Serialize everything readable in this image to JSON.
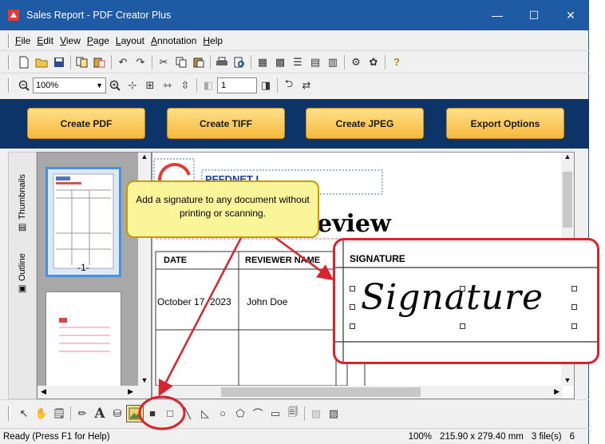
{
  "window": {
    "title": "Sales Report - PDF Creator Plus",
    "minimize": "—",
    "maximize": "☐",
    "close": "✕"
  },
  "menu": [
    "File",
    "Edit",
    "View",
    "Page",
    "Layout",
    "Annotation",
    "Help"
  ],
  "toolbar2": {
    "zoom_value": "100%",
    "page_number": "1"
  },
  "actions": {
    "create_pdf": "Create PDF",
    "create_tiff": "Create TIFF",
    "create_jpeg": "Create JPEG",
    "export_options": "Export Options"
  },
  "sidetabs": {
    "thumbnails": "Thumbnails",
    "outline": "Outline"
  },
  "thumbnails": [
    {
      "label": "-1-"
    }
  ],
  "document": {
    "company_text": "PFFDNET I",
    "review_heading": "eview",
    "table_headers": {
      "date": "DATE",
      "reviewer": "REVIEWER NAME"
    },
    "row": {
      "date": "October 17, 2023",
      "reviewer": "John Doe"
    }
  },
  "callout": {
    "text": "Add a signature to any document without printing or scanning."
  },
  "signature": {
    "header": "SIGNATURE",
    "script_text": "Signature"
  },
  "bottom_tools": {
    "text_tool": "A"
  },
  "status": {
    "message": "Ready (Press F1 for Help)",
    "zoom": "100%",
    "page_size": "215.90 x 279.40 mm",
    "files": "3 file(s)",
    "page": "6"
  },
  "colors": {
    "title_bar": "#1f5aa5",
    "action_band": "#0d3468",
    "button_gold": "#f6b93b",
    "highlight_red": "#d9232d",
    "callout_yellow": "#fbf59a"
  }
}
